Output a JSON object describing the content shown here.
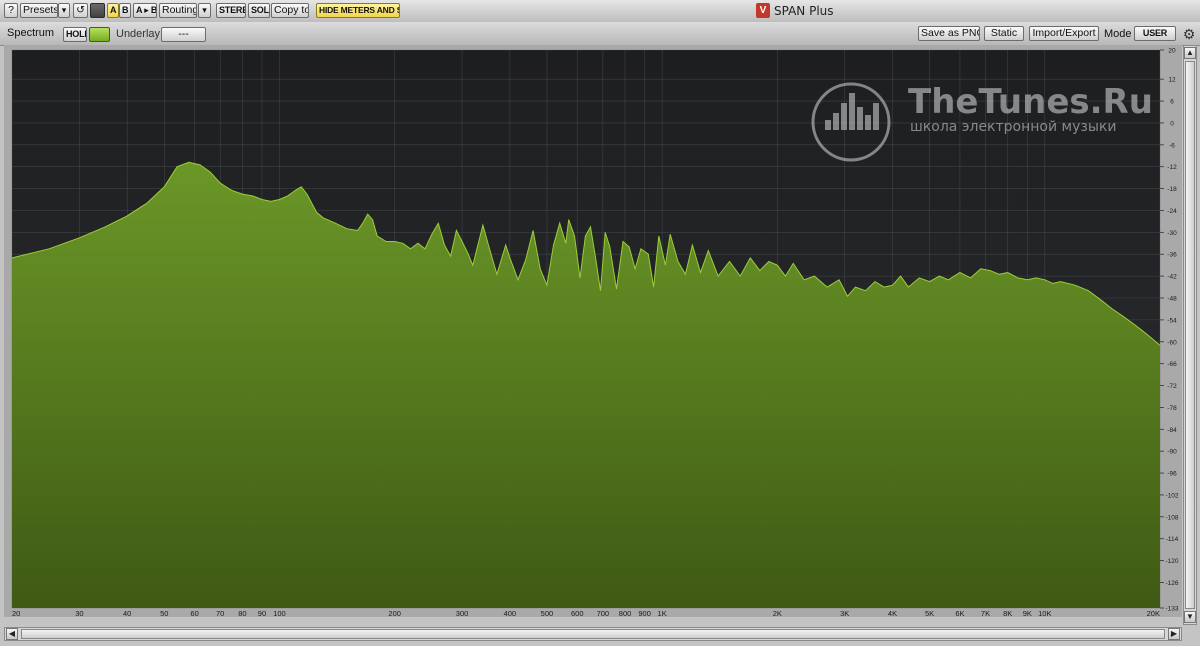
{
  "window": {
    "title": "SPAN Plus"
  },
  "toolbar": {
    "help_label": "?",
    "presets_label": "Presets",
    "presets_arrow": "▾",
    "undo_glyph": "↺",
    "a_label": "A",
    "b_label": "B",
    "ab_label": "A ▸ B",
    "routing_label": "Routing",
    "routing_arrow": "▾",
    "stereo_label": "STEREO",
    "solo_label": "SOLO",
    "copy_to_label": "Copy to",
    "hide_meters_label": "HIDE METERS AND STATS"
  },
  "subbar": {
    "spectrum_label": "Spectrum",
    "hold_label": "HOLD",
    "underlay_label": "Underlay",
    "underlay_value": "---",
    "save_png_label": "Save as PNG",
    "static_label": "Static",
    "import_export_label": "Import/Export",
    "mode_label": "Mode",
    "mode_value": "USER"
  },
  "colors": {
    "plot_bg_top": "#1d1e20",
    "plot_bg_bottom": "#2c2e31",
    "fill_top": "#6b9728",
    "fill_bottom": "#3f5a14",
    "edge": "#9ccc3a"
  },
  "watermark": {
    "brand": "TheTunes.Ru",
    "tagline": "школа электронной музыки"
  },
  "chart_data": {
    "type": "area",
    "x_scale": "log",
    "xlim": [
      20,
      20000
    ],
    "ylim": [
      -133,
      20
    ],
    "grid": true,
    "x_ticks": [
      {
        "v": 20,
        "label": "20"
      },
      {
        "v": 30,
        "label": "30"
      },
      {
        "v": 40,
        "label": "40"
      },
      {
        "v": 50,
        "label": "50"
      },
      {
        "v": 60,
        "label": "60"
      },
      {
        "v": 70,
        "label": "70"
      },
      {
        "v": 80,
        "label": "80"
      },
      {
        "v": 90,
        "label": "90"
      },
      {
        "v": 100,
        "label": "100"
      },
      {
        "v": 200,
        "label": "200"
      },
      {
        "v": 300,
        "label": "300"
      },
      {
        "v": 400,
        "label": "400"
      },
      {
        "v": 500,
        "label": "500"
      },
      {
        "v": 600,
        "label": "600"
      },
      {
        "v": 700,
        "label": "700"
      },
      {
        "v": 800,
        "label": "800"
      },
      {
        "v": 900,
        "label": "900"
      },
      {
        "v": 1000,
        "label": "1K"
      },
      {
        "v": 2000,
        "label": "2K"
      },
      {
        "v": 3000,
        "label": "3K"
      },
      {
        "v": 4000,
        "label": "4K"
      },
      {
        "v": 5000,
        "label": "5K"
      },
      {
        "v": 6000,
        "label": "6K"
      },
      {
        "v": 7000,
        "label": "7K"
      },
      {
        "v": 8000,
        "label": "8K"
      },
      {
        "v": 9000,
        "label": "9K"
      },
      {
        "v": 10000,
        "label": "10K"
      },
      {
        "v": 20000,
        "label": "20K"
      }
    ],
    "y_ticks": [
      {
        "v": 20,
        "label": "20"
      },
      {
        "v": 12,
        "label": "12"
      },
      {
        "v": 6,
        "label": "6"
      },
      {
        "v": 0,
        "label": "0"
      },
      {
        "v": -6,
        "label": "-6"
      },
      {
        "v": -12,
        "label": "-12"
      },
      {
        "v": -18,
        "label": "-18"
      },
      {
        "v": -24,
        "label": "-24"
      },
      {
        "v": -30,
        "label": "-30"
      },
      {
        "v": -36,
        "label": "-36"
      },
      {
        "v": -42,
        "label": "-42"
      },
      {
        "v": -48,
        "label": "-48"
      },
      {
        "v": -54,
        "label": "-54"
      },
      {
        "v": -60,
        "label": "-60"
      },
      {
        "v": -66,
        "label": "-66"
      },
      {
        "v": -72,
        "label": "-72"
      },
      {
        "v": -78,
        "label": "-78"
      },
      {
        "v": -84,
        "label": "-84"
      },
      {
        "v": -90,
        "label": "-90"
      },
      {
        "v": -96,
        "label": "-96"
      },
      {
        "v": -102,
        "label": "-102"
      },
      {
        "v": -108,
        "label": "-108"
      },
      {
        "v": -114,
        "label": "-114"
      },
      {
        "v": -120,
        "label": "-120"
      },
      {
        "v": -126,
        "label": "-126"
      },
      {
        "v": -133,
        "label": "-133"
      }
    ],
    "series": [
      {
        "points": [
          [
            20,
            -37
          ],
          [
            25,
            -34.5
          ],
          [
            30,
            -31.5
          ],
          [
            35,
            -28.5
          ],
          [
            40,
            -25.5
          ],
          [
            45,
            -22
          ],
          [
            50,
            -17.5
          ],
          [
            54,
            -12
          ],
          [
            58,
            -10.8
          ],
          [
            62,
            -11.5
          ],
          [
            66,
            -13.5
          ],
          [
            70,
            -16.5
          ],
          [
            75,
            -18.5
          ],
          [
            80,
            -19.5
          ],
          [
            85,
            -20
          ],
          [
            90,
            -21
          ],
          [
            95,
            -21.5
          ],
          [
            100,
            -21
          ],
          [
            105,
            -20
          ],
          [
            110,
            -18.5
          ],
          [
            114,
            -17.5
          ],
          [
            118,
            -19.5
          ],
          [
            125,
            -24.5
          ],
          [
            130,
            -26
          ],
          [
            140,
            -27.5
          ],
          [
            150,
            -29
          ],
          [
            160,
            -29.5
          ],
          [
            165,
            -27.5
          ],
          [
            170,
            -25
          ],
          [
            175,
            -26.5
          ],
          [
            180,
            -31
          ],
          [
            190,
            -32.5
          ],
          [
            200,
            -32.5
          ],
          [
            210,
            -33
          ],
          [
            220,
            -34.5
          ],
          [
            230,
            -33
          ],
          [
            240,
            -34.5
          ],
          [
            250,
            -30.5
          ],
          [
            260,
            -27.5
          ],
          [
            270,
            -33.5
          ],
          [
            280,
            -36.5
          ],
          [
            290,
            -29.5
          ],
          [
            300,
            -32.5
          ],
          [
            310,
            -35.5
          ],
          [
            320,
            -39
          ],
          [
            340,
            -28
          ],
          [
            355,
            -35
          ],
          [
            370,
            -41.5
          ],
          [
            390,
            -33.5
          ],
          [
            400,
            -37
          ],
          [
            420,
            -43
          ],
          [
            440,
            -37.5
          ],
          [
            460,
            -29.5
          ],
          [
            480,
            -40
          ],
          [
            500,
            -44.5
          ],
          [
            520,
            -33.5
          ],
          [
            540,
            -27.5
          ],
          [
            560,
            -33
          ],
          [
            570,
            -26.5
          ],
          [
            590,
            -31
          ],
          [
            610,
            -42.5
          ],
          [
            630,
            -31
          ],
          [
            650,
            -28.5
          ],
          [
            670,
            -37
          ],
          [
            690,
            -46
          ],
          [
            710,
            -30
          ],
          [
            730,
            -34
          ],
          [
            760,
            -45.5
          ],
          [
            790,
            -32.5
          ],
          [
            820,
            -34
          ],
          [
            850,
            -40
          ],
          [
            880,
            -34.5
          ],
          [
            920,
            -36
          ],
          [
            950,
            -45
          ],
          [
            980,
            -31
          ],
          [
            1020,
            -39
          ],
          [
            1050,
            -30.5
          ],
          [
            1100,
            -38
          ],
          [
            1150,
            -41.5
          ],
          [
            1200,
            -33.5
          ],
          [
            1260,
            -41
          ],
          [
            1320,
            -35
          ],
          [
            1400,
            -42
          ],
          [
            1500,
            -38
          ],
          [
            1600,
            -42
          ],
          [
            1700,
            -37
          ],
          [
            1800,
            -40.5
          ],
          [
            1900,
            -38
          ],
          [
            2000,
            -39
          ],
          [
            2100,
            -42
          ],
          [
            2200,
            -38.5
          ],
          [
            2350,
            -43
          ],
          [
            2500,
            -42
          ],
          [
            2700,
            -45
          ],
          [
            2900,
            -43
          ],
          [
            3050,
            -47.5
          ],
          [
            3200,
            -45
          ],
          [
            3400,
            -46
          ],
          [
            3600,
            -43.5
          ],
          [
            3800,
            -45
          ],
          [
            4000,
            -44.5
          ],
          [
            4200,
            -42
          ],
          [
            4400,
            -45
          ],
          [
            4700,
            -42.5
          ],
          [
            5000,
            -43.5
          ],
          [
            5300,
            -42
          ],
          [
            5600,
            -43
          ],
          [
            6000,
            -41
          ],
          [
            6400,
            -42.5
          ],
          [
            6800,
            -40
          ],
          [
            7200,
            -40.5
          ],
          [
            7600,
            -41.5
          ],
          [
            8000,
            -41
          ],
          [
            8500,
            -42.5
          ],
          [
            9000,
            -43
          ],
          [
            9500,
            -42.5
          ],
          [
            10000,
            -43
          ],
          [
            10500,
            -44
          ],
          [
            11000,
            -43.5
          ],
          [
            12000,
            -44.5
          ],
          [
            13000,
            -46
          ],
          [
            14000,
            -48.5
          ],
          [
            15000,
            -51
          ],
          [
            16000,
            -53
          ],
          [
            17000,
            -55
          ],
          [
            18000,
            -57
          ],
          [
            19000,
            -59
          ],
          [
            20000,
            -61
          ]
        ]
      }
    ]
  }
}
